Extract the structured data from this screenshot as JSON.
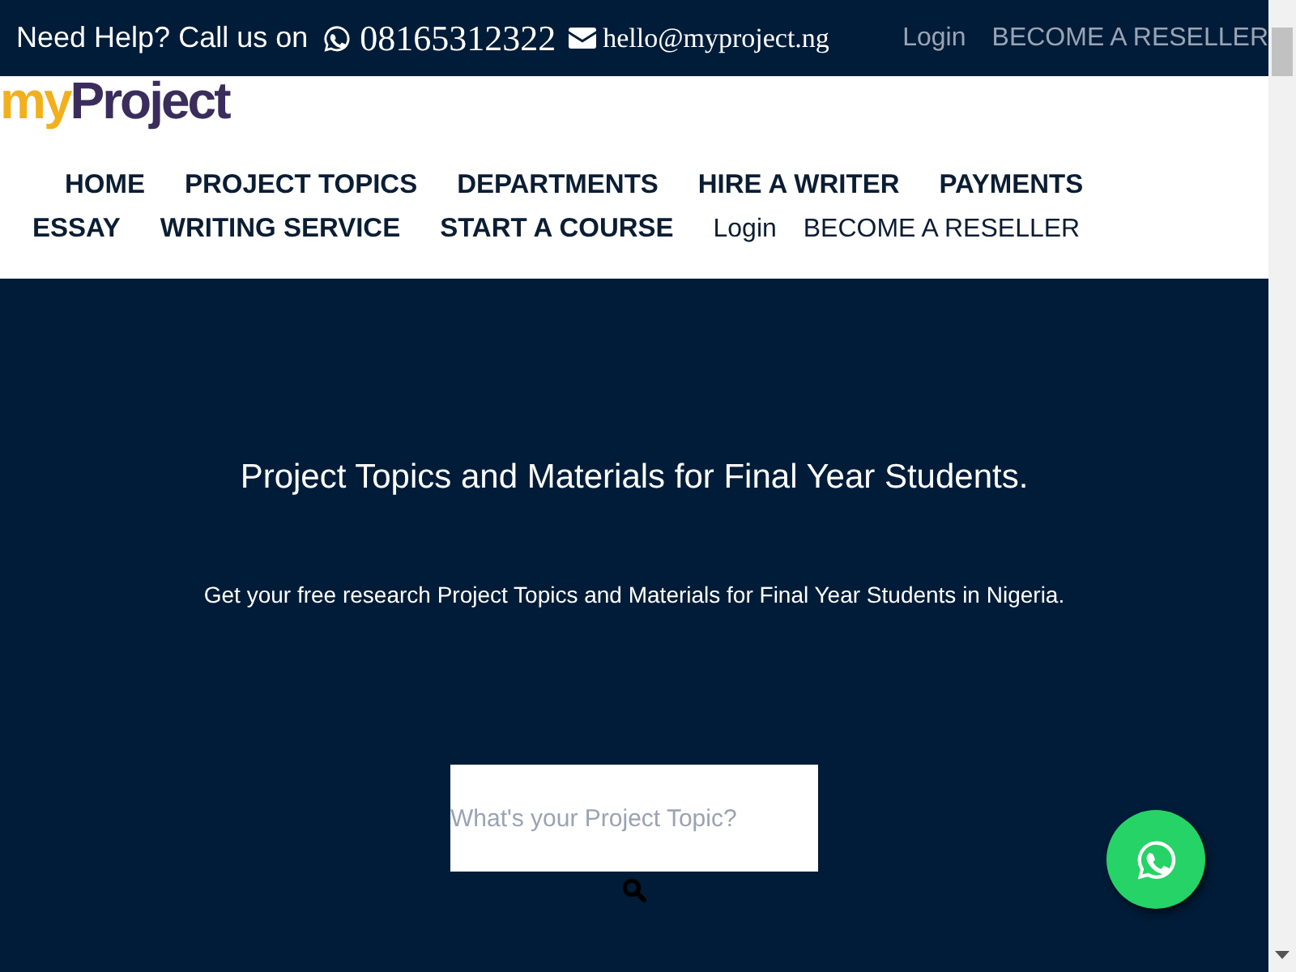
{
  "topbar": {
    "help_text": "Need Help? Call us on",
    "phone": "08165312322",
    "email": "hello@myproject.ng",
    "links": [
      "Login",
      "BECOME A RESELLER"
    ]
  },
  "logo": {
    "part_1": "my",
    "part_2": "Project"
  },
  "nav": [
    {
      "label": "HOME",
      "kind": "main"
    },
    {
      "label": "PROJECT TOPICS",
      "kind": "main"
    },
    {
      "label": "DEPARTMENTS",
      "kind": "main"
    },
    {
      "label": "HIRE A WRITER",
      "kind": "main"
    },
    {
      "label": "PAYMENTS",
      "kind": "main"
    },
    {
      "label": "ESSAY",
      "kind": "main"
    },
    {
      "label": "WRITING SERVICE",
      "kind": "main"
    },
    {
      "label": "START A COURSE",
      "kind": "main"
    },
    {
      "label": "Login",
      "kind": "plain"
    },
    {
      "label": "BECOME A RESELLER",
      "kind": "plain"
    }
  ],
  "hero": {
    "title": "Project Topics and Materials for Final Year Students.",
    "subtitle": "Get your free research Project Topics and Materials for Final Year Students in Nigeria.",
    "search": {
      "placeholder": "What's your Project Topic?"
    }
  }
}
